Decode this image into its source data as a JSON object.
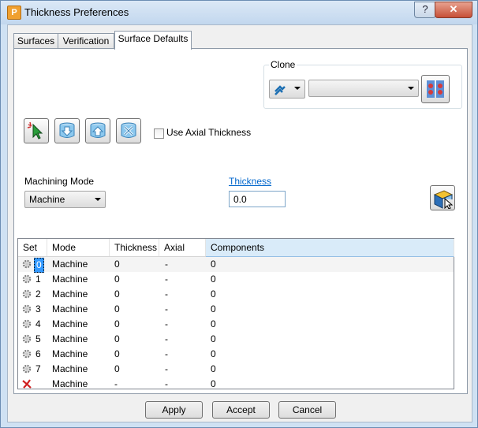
{
  "window": {
    "title": "Thickness Preferences",
    "help_label": "?",
    "close_label": "✕",
    "app_icon_letter": "P"
  },
  "tabs": [
    {
      "label": "Surfaces",
      "active": false
    },
    {
      "label": "Verification",
      "active": false
    },
    {
      "label": "Surface Defaults",
      "active": true
    }
  ],
  "clone": {
    "label": "Clone",
    "selected_value": ""
  },
  "toolbar": {
    "icons": [
      "select-pointer-icon",
      "thickness-down-icon",
      "thickness-up-icon",
      "tools-icon"
    ]
  },
  "axial_checkbox": {
    "label": "Use Axial Thickness",
    "checked": false
  },
  "machining_mode": {
    "label": "Machining Mode",
    "selected": "Machine"
  },
  "thickness": {
    "label": "Thickness",
    "value": "0.0"
  },
  "table": {
    "columns": [
      "Set",
      "Mode",
      "Thickness",
      "Axial",
      "Components"
    ],
    "rows": [
      {
        "set": "0",
        "mode": "Machine",
        "thickness": "0",
        "axial": "-",
        "components": "0",
        "icon": "gear-icon",
        "selected": true
      },
      {
        "set": "1",
        "mode": "Machine",
        "thickness": "0",
        "axial": "-",
        "components": "0",
        "icon": "gear-icon"
      },
      {
        "set": "2",
        "mode": "Machine",
        "thickness": "0",
        "axial": "-",
        "components": "0",
        "icon": "gear-icon"
      },
      {
        "set": "3",
        "mode": "Machine",
        "thickness": "0",
        "axial": "-",
        "components": "0",
        "icon": "gear-icon"
      },
      {
        "set": "4",
        "mode": "Machine",
        "thickness": "0",
        "axial": "-",
        "components": "0",
        "icon": "gear-icon"
      },
      {
        "set": "5",
        "mode": "Machine",
        "thickness": "0",
        "axial": "-",
        "components": "0",
        "icon": "gear-icon"
      },
      {
        "set": "6",
        "mode": "Machine",
        "thickness": "0",
        "axial": "-",
        "components": "0",
        "icon": "gear-icon"
      },
      {
        "set": "7",
        "mode": "Machine",
        "thickness": "0",
        "axial": "-",
        "components": "0",
        "icon": "gear-icon"
      },
      {
        "set": "",
        "mode": "Machine",
        "thickness": "-",
        "axial": "-",
        "components": "0",
        "icon": "red-x-icon"
      }
    ]
  },
  "buttons": {
    "apply": "Apply",
    "accept": "Accept",
    "cancel": "Cancel"
  }
}
